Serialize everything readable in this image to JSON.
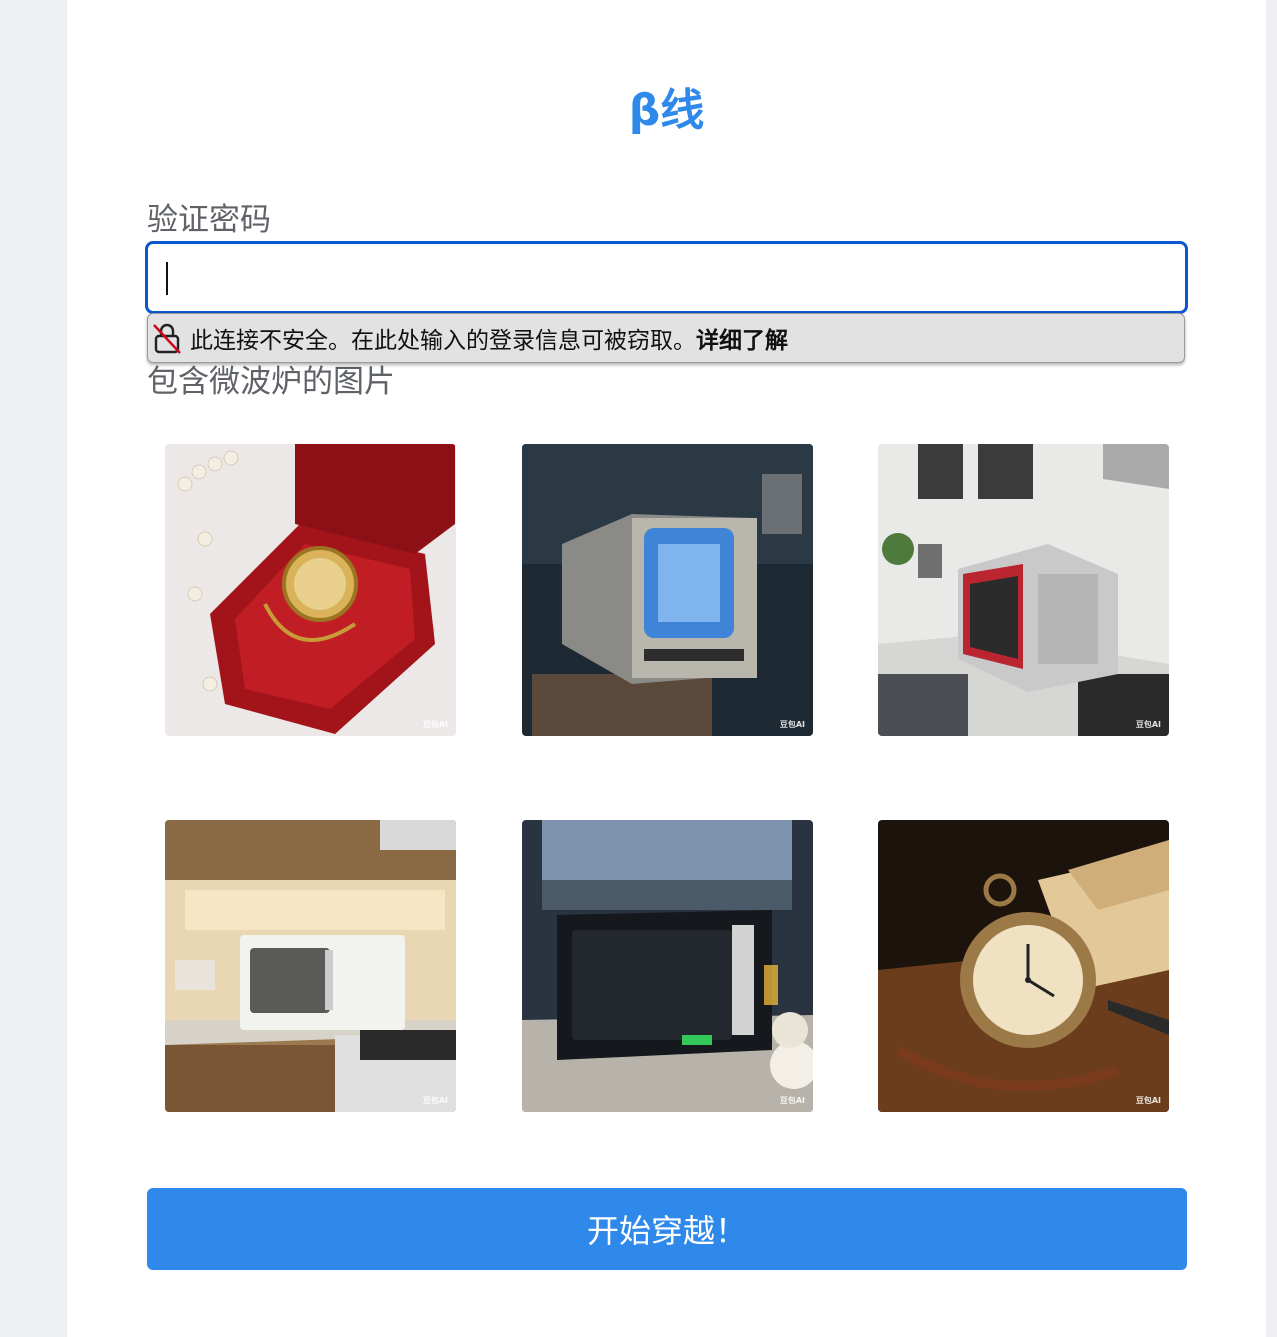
{
  "app": {
    "title": "β线"
  },
  "password": {
    "label": "验证密码",
    "value": ""
  },
  "security_warning": {
    "text": "此连接不安全。在此处输入的登录信息可被窃取。",
    "link": "详细了解",
    "icon": "unlocked-padlock-icon"
  },
  "captcha": {
    "prompt": "包含微波炉的图片",
    "images": [
      {
        "watermark": "豆包AI",
        "subject": "gold pocket watch in red velvet box with pearls"
      },
      {
        "watermark": "豆包AI",
        "subject": "old CRT television in junk room"
      },
      {
        "watermark": "豆包AI",
        "subject": "silver microwave in white kitchen"
      },
      {
        "watermark": "豆包AI",
        "subject": "white microwave on kitchen counter"
      },
      {
        "watermark": "豆包AI",
        "subject": "black microwave on dining table"
      },
      {
        "watermark": "豆包AI",
        "subject": "antique pocket watch on wooden table with book"
      }
    ]
  },
  "submit": {
    "label": "开始穿越！"
  },
  "colors": {
    "accent": "#2e89ea",
    "focus_ring": "#0b57d0",
    "background": "#eef0f4"
  }
}
